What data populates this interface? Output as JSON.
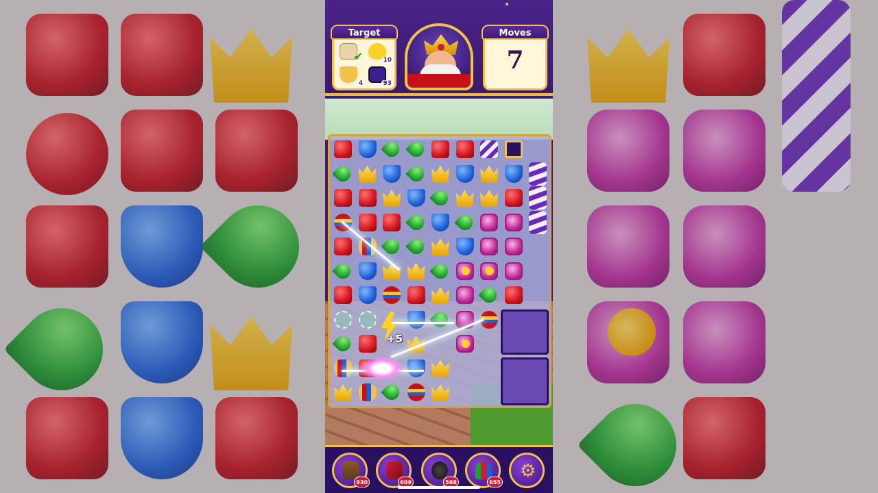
{
  "hud": {
    "target_label": "Target",
    "moves_label": "Moves",
    "moves_value": "7",
    "targets": [
      {
        "icon": "scroll-icon",
        "count": "",
        "done": true
      },
      {
        "icon": "rubber-duck-icon",
        "count": "10",
        "done": false
      },
      {
        "icon": "teacup-icon",
        "count": "4",
        "done": false
      },
      {
        "icon": "purple-tile-icon",
        "count": "93",
        "done": false
      }
    ],
    "portrait_icon": "king-robert-icon"
  },
  "board": {
    "effects": {
      "combo_label": "+5",
      "bolt_icon": "lightning-bolt-icon"
    }
  },
  "boosters": [
    {
      "name": "hammer",
      "icon": "hammer-icon",
      "count": "930"
    },
    {
      "name": "arrow",
      "icon": "arrow-icon",
      "count": "609"
    },
    {
      "name": "cannon",
      "icon": "cannon-icon",
      "count": "568"
    },
    {
      "name": "jester",
      "icon": "jester-hat-icon",
      "count": "655"
    },
    {
      "name": "settings",
      "icon": "gear-icon",
      "count": ""
    }
  ],
  "colors": {
    "frame_gold": "#f2c14a",
    "header_purple": "#3a1a6e",
    "badge_red": "#d11b36"
  }
}
